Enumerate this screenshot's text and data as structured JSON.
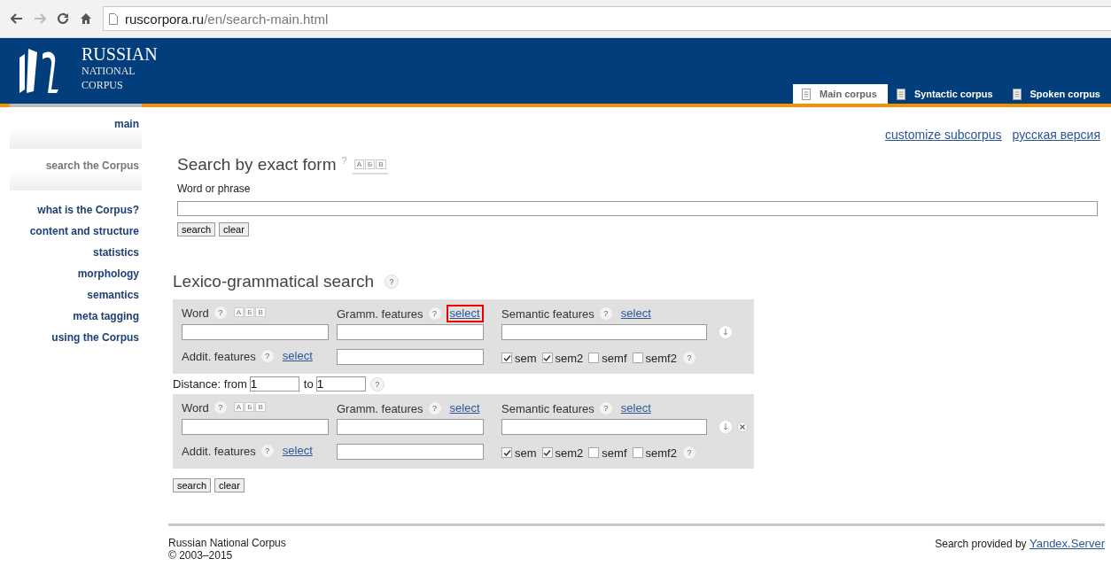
{
  "browser": {
    "url_host": "ruscorpora.ru",
    "url_path": "/en/search-main.html"
  },
  "header": {
    "title": "RUSSIAN",
    "subtitle_1": "NATIONAL",
    "subtitle_2": "CORPUS"
  },
  "tabs": [
    {
      "label": "Main corpus",
      "selected": true
    },
    {
      "label": "Syntactic corpus",
      "selected": false
    },
    {
      "label": "Spoken corpus",
      "selected": false
    }
  ],
  "sidebar": {
    "items": [
      {
        "label": "main",
        "kind": "block",
        "selected": false
      },
      {
        "label": "search the Corpus",
        "kind": "block",
        "selected": true
      },
      {
        "label": "what is the Corpus?",
        "kind": "link",
        "selected": false
      },
      {
        "label": "content and structure",
        "kind": "link",
        "selected": false
      },
      {
        "label": "statistics",
        "kind": "link",
        "selected": false
      },
      {
        "label": "morphology",
        "kind": "link",
        "selected": false
      },
      {
        "label": "semantics",
        "kind": "link",
        "selected": false
      },
      {
        "label": "meta tagging",
        "kind": "link",
        "selected": false
      },
      {
        "label": "using the Corpus",
        "kind": "link",
        "selected": false
      }
    ]
  },
  "top_links": [
    "customize subcorpus",
    "русская версия"
  ],
  "exact_search": {
    "title": "Search by exact form",
    "help": "?",
    "keyboard": [
      "А",
      "Б",
      "В"
    ],
    "field_label": "Word or phrase",
    "buttons": [
      "search",
      "clear"
    ]
  },
  "lexgram_search": {
    "title": "Lexico-grammatical search",
    "help": "?",
    "groups": [
      {
        "word_label": "Word",
        "keyboard": [
          "А",
          "Б",
          "В"
        ],
        "gramm_label": "Gramm. features",
        "gramm_link": {
          "label": "select",
          "highlighted": true
        },
        "sem_label": "Semantic features",
        "sem_link": "select",
        "addit_label": "Addit. features",
        "addit_link": "select",
        "checkboxes": [
          {
            "label": "sem",
            "checked": true
          },
          {
            "label": "sem2",
            "checked": true
          },
          {
            "label": "semf",
            "checked": false
          },
          {
            "label": "semf2",
            "checked": false
          }
        ],
        "removable": false
      },
      {
        "word_label": "Word",
        "keyboard": [
          "А",
          "Б",
          "В"
        ],
        "gramm_label": "Gramm. features",
        "gramm_link": {
          "label": "select",
          "highlighted": false
        },
        "sem_label": "Semantic features",
        "sem_link": "select",
        "addit_label": "Addit. features",
        "addit_link": "select",
        "checkboxes": [
          {
            "label": "sem",
            "checked": true
          },
          {
            "label": "sem2",
            "checked": true
          },
          {
            "label": "semf",
            "checked": false
          },
          {
            "label": "semf2",
            "checked": false
          }
        ],
        "removable": true
      }
    ],
    "distance": {
      "label_from": "Distance: from",
      "from_value": "1",
      "label_to": "to",
      "to_value": "1"
    },
    "buttons": [
      "search",
      "clear"
    ]
  },
  "footer": {
    "name": "Russian National Corpus",
    "copyright": "© 2003–2015",
    "provided_by": "Search provided by",
    "provider_link": "Yandex.Server"
  }
}
